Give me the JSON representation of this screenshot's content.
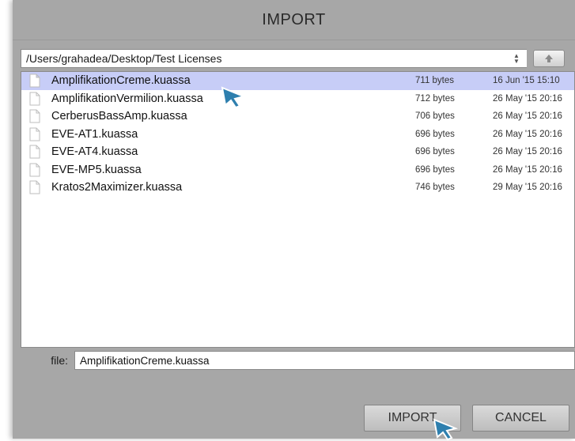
{
  "dialog": {
    "title": "IMPORT"
  },
  "path": {
    "value": "/Users/grahadea/Desktop/Test Licenses"
  },
  "files": [
    {
      "name": "AmplifikationCreme.kuassa",
      "size": "711 bytes",
      "date": "16 Jun '15 15:10",
      "selected": true
    },
    {
      "name": "AmplifikationVermilion.kuassa",
      "size": "712 bytes",
      "date": "26 May '15 20:16",
      "selected": false
    },
    {
      "name": "CerberusBassAmp.kuassa",
      "size": "706 bytes",
      "date": "26 May '15 20:16",
      "selected": false
    },
    {
      "name": "EVE-AT1.kuassa",
      "size": "696 bytes",
      "date": "26 May '15 20:16",
      "selected": false
    },
    {
      "name": "EVE-AT4.kuassa",
      "size": "696 bytes",
      "date": "26 May '15 20:16",
      "selected": false
    },
    {
      "name": "EVE-MP5.kuassa",
      "size": "696 bytes",
      "date": "26 May '15 20:16",
      "selected": false
    },
    {
      "name": "Kratos2Maximizer.kuassa",
      "size": "746 bytes",
      "date": "29 May '15 20:16",
      "selected": false
    }
  ],
  "filebar": {
    "label": "file:",
    "value": "AmplifikationCreme.kuassa"
  },
  "buttons": {
    "import_label": "IMPORT",
    "cancel_label": "CANCEL"
  },
  "icons": {
    "path_stepper": "up-down-chevron-icon",
    "up_button": "up-arrow-icon",
    "file": "document-icon",
    "cursor": "pointer-cursor-icon"
  },
  "colors": {
    "dialog_bg": "#a7a7a7",
    "selection": "#c7cdf7",
    "cursor": "#2e7fae"
  }
}
